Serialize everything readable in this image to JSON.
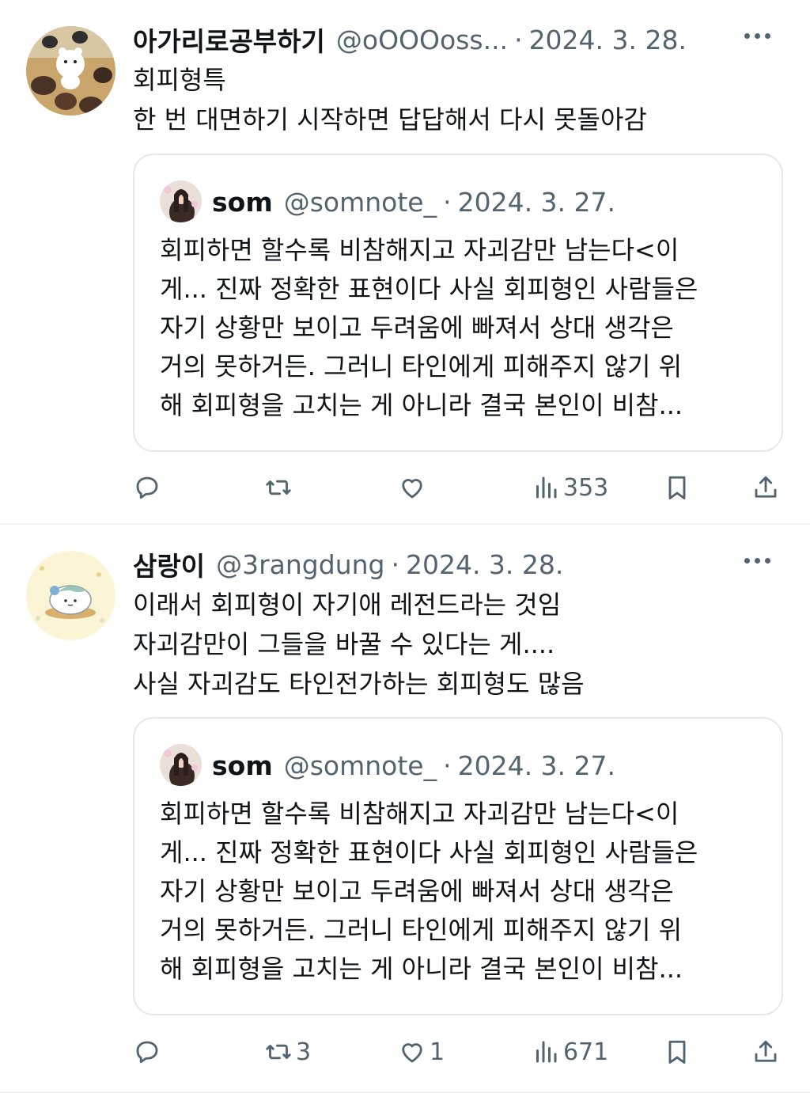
{
  "tweets": [
    {
      "name": "아가리로공부하기",
      "handle": "@oOOOoss...",
      "date": "2024. 3. 28.",
      "text_lines": [
        "회피형특",
        "한 번 대면하기 시작하면 답답해서 다시 못돌아감"
      ],
      "quote": {
        "name": "som",
        "handle": "@somnote_",
        "date": "2024. 3. 27.",
        "text_lines": [
          "회피하면 할수록 비참해지고 자괴감만 남는다<이",
          "게... 진짜 정확한 표현이다 사실 회피형인 사람들은",
          "자기 상황만 보이고 두려움에 빠져서 상대 생각은",
          "거의 못하거든. 그러니 타인에게 피해주지 않기 위",
          "해 회피형을 고치는 게 아니라 결국 본인이 비참..."
        ]
      },
      "actions": {
        "reply": "",
        "retweet": "",
        "like": "",
        "views": "353"
      }
    },
    {
      "name": "삼랑이",
      "handle": "@3rangdung",
      "date": "2024. 3. 28.",
      "text_lines": [
        "이래서 회피형이 자기애 레전드라는 것임",
        "자괴감만이 그들을 바꿀 수 있다는 게....",
        "사실 자괴감도 타인전가하는 회피형도 많음"
      ],
      "quote": {
        "name": "som",
        "handle": "@somnote_",
        "date": "2024. 3. 27.",
        "text_lines": [
          "회피하면 할수록 비참해지고 자괴감만 남는다<이",
          "게... 진짜 정확한 표현이다 사실 회피형인 사람들은",
          "자기 상황만 보이고 두려움에 빠져서 상대 생각은",
          "거의 못하거든. 그러니 타인에게 피해주지 않기 위",
          "해 회피형을 고치는 게 아니라 결국 본인이 비참..."
        ]
      },
      "actions": {
        "reply": "",
        "retweet": "3",
        "like": "1",
        "views": "671"
      }
    }
  ],
  "sep": "·",
  "icons": [
    "more-icon",
    "reply-icon",
    "retweet-icon",
    "like-icon",
    "views-icon",
    "bookmark-icon",
    "share-icon"
  ],
  "colors": {
    "text": "#0f1419",
    "secondary": "#536471",
    "border": "#e4e9ec"
  }
}
